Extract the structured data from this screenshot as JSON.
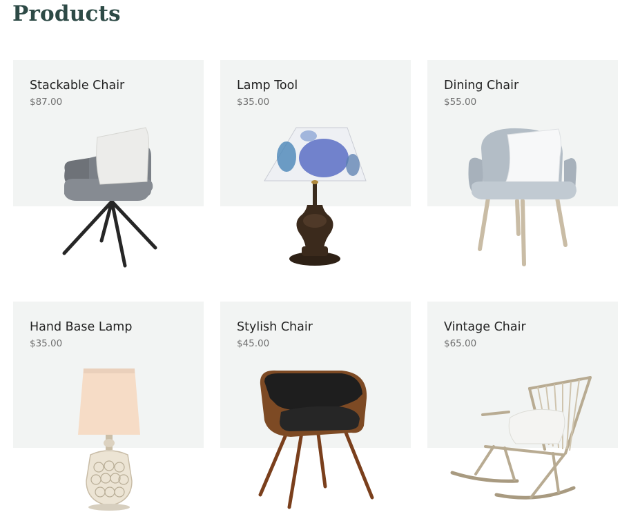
{
  "page": {
    "title": "Products"
  },
  "products": [
    {
      "name": "Stackable Chair",
      "price": "$87.00",
      "icon": "stackable-chair-icon"
    },
    {
      "name": "Lamp Tool",
      "price": "$35.00",
      "icon": "table-lamp-icon"
    },
    {
      "name": "Dining Chair",
      "price": "$55.00",
      "icon": "dining-chair-icon"
    },
    {
      "name": "Hand Base Lamp",
      "price": "$35.00",
      "icon": "crystal-lamp-icon"
    },
    {
      "name": "Stylish Chair",
      "price": "$45.00",
      "icon": "stylish-chair-icon"
    },
    {
      "name": "Vintage Chair",
      "price": "$65.00",
      "icon": "rocking-chair-icon"
    }
  ]
}
